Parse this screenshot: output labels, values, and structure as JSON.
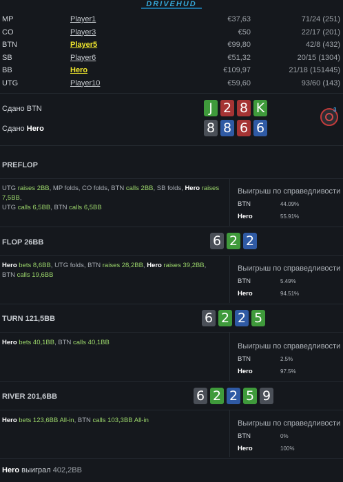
{
  "logo": "DRIVEHUD",
  "players": [
    {
      "pos": "MP",
      "name": "Player1",
      "stack": "€37,63",
      "stat": "71/24 (251)",
      "highlight": false
    },
    {
      "pos": "CO",
      "name": "Player3",
      "stack": "€50",
      "stat": "22/17 (201)",
      "highlight": false
    },
    {
      "pos": "BTN",
      "name": "Player5",
      "stack": "€99,80",
      "stat": "42/8 (432)",
      "highlight": true
    },
    {
      "pos": "SB",
      "name": "Player6",
      "stack": "€51,32",
      "stat": "20/15 (1304)",
      "highlight": false
    },
    {
      "pos": "BB",
      "name": "Hero",
      "stack": "€109,97",
      "stat": "21/18 (151445)",
      "highlight": true
    },
    {
      "pos": "UTG",
      "name": "Player10",
      "stack": "€59,60",
      "stat": "93/60 (143)",
      "highlight": false
    }
  ],
  "dealt": {
    "btn_label": "Сдано BTN",
    "hero_prefix": "Сдано",
    "hero_name": "Hero",
    "btn_cards": [
      {
        "rank": "J",
        "suit": "green"
      },
      {
        "rank": "2",
        "suit": "red"
      },
      {
        "rank": "8",
        "suit": "red"
      },
      {
        "rank": "K",
        "suit": "green"
      }
    ],
    "hero_cards": [
      {
        "rank": "8",
        "suit": "grey"
      },
      {
        "rank": "8",
        "suit": "blue"
      },
      {
        "rank": "6",
        "suit": "red"
      },
      {
        "rank": "6",
        "suit": "blue"
      }
    ]
  },
  "equity_title": "Выигрыш по справедливости",
  "streets": {
    "preflop": {
      "title": "PREFLOP",
      "actions": [
        [
          {
            "t": "UTG",
            "c": "p"
          },
          {
            "t": " raises ",
            "c": "act"
          },
          {
            "t": "2BB",
            "c": "amt"
          },
          {
            "t": ", MP folds, CO folds, BTN ",
            "c": "p"
          },
          {
            "t": "calls ",
            "c": "act"
          },
          {
            "t": "2BB",
            "c": "amt"
          },
          {
            "t": ", SB folds, ",
            "c": "p"
          },
          {
            "t": "Hero",
            "c": "hero"
          },
          {
            "t": " raises ",
            "c": "act"
          },
          {
            "t": "7,5BB",
            "c": "amt"
          },
          {
            "t": ",",
            "c": "p"
          }
        ],
        [
          {
            "t": "UTG ",
            "c": "p"
          },
          {
            "t": "calls ",
            "c": "act"
          },
          {
            "t": "6,5BB",
            "c": "amt"
          },
          {
            "t": ", BTN ",
            "c": "p"
          },
          {
            "t": "calls ",
            "c": "act"
          },
          {
            "t": "6,5BB",
            "c": "amt"
          }
        ]
      ],
      "equity": {
        "btn": "44.09%",
        "hero": "55.91%"
      }
    },
    "flop": {
      "title": "FLOP 26BB",
      "board": [
        {
          "rank": "6",
          "suit": "grey"
        },
        {
          "rank": "2",
          "suit": "green"
        },
        {
          "rank": "2",
          "suit": "blue"
        }
      ],
      "actions": [
        [
          {
            "t": "Hero",
            "c": "hero"
          },
          {
            "t": " bets ",
            "c": "act"
          },
          {
            "t": "8,6BB",
            "c": "amt"
          },
          {
            "t": ", UTG folds, BTN ",
            "c": "p"
          },
          {
            "t": "raises ",
            "c": "act"
          },
          {
            "t": "28,2BB",
            "c": "amt"
          },
          {
            "t": ", ",
            "c": "p"
          },
          {
            "t": "Hero",
            "c": "hero"
          },
          {
            "t": " raises ",
            "c": "act"
          },
          {
            "t": "39,2BB",
            "c": "amt"
          },
          {
            "t": ",",
            "c": "p"
          }
        ],
        [
          {
            "t": "BTN ",
            "c": "p"
          },
          {
            "t": "calls ",
            "c": "act"
          },
          {
            "t": "19,6BB",
            "c": "amt"
          }
        ]
      ],
      "equity": {
        "btn": "5.49%",
        "hero": "94.51%"
      }
    },
    "turn": {
      "title": "TURN 121,5BB",
      "board": [
        {
          "rank": "6",
          "suit": "grey"
        },
        {
          "rank": "2",
          "suit": "green"
        },
        {
          "rank": "2",
          "suit": "blue"
        },
        {
          "rank": "5",
          "suit": "green"
        }
      ],
      "actions": [
        [
          {
            "t": "Hero",
            "c": "hero"
          },
          {
            "t": " bets ",
            "c": "act"
          },
          {
            "t": "40,1BB",
            "c": "amt"
          },
          {
            "t": ", BTN ",
            "c": "p"
          },
          {
            "t": "calls ",
            "c": "act"
          },
          {
            "t": "40,1BB",
            "c": "amt"
          }
        ]
      ],
      "equity": {
        "btn": "2.5%",
        "hero": "97.5%"
      }
    },
    "river": {
      "title": "RIVER 201,6BB",
      "board": [
        {
          "rank": "6",
          "suit": "grey"
        },
        {
          "rank": "2",
          "suit": "green"
        },
        {
          "rank": "2",
          "suit": "blue"
        },
        {
          "rank": "5",
          "suit": "green"
        },
        {
          "rank": "9",
          "suit": "grey"
        }
      ],
      "actions": [
        [
          {
            "t": "Hero",
            "c": "hero"
          },
          {
            "t": " bets ",
            "c": "act"
          },
          {
            "t": "123,6BB All-in",
            "c": "amt"
          },
          {
            "t": ", BTN ",
            "c": "p"
          },
          {
            "t": "calls ",
            "c": "act"
          },
          {
            "t": "103,3BB All-in",
            "c": "amt"
          }
        ]
      ],
      "equity": {
        "btn": "0%",
        "hero": "100%"
      }
    }
  },
  "equity_labels": {
    "btn": "BTN",
    "hero": "Hero"
  },
  "result": {
    "hero": "Hero",
    "text": " выиграл ",
    "amount": "402,2BB"
  },
  "colors": {
    "green": "#3f9a3b",
    "red": "#a53434",
    "blue": "#2f5aa4",
    "grey": "#4a4f57",
    "highlight": "#f2e82d",
    "action": "#9ad46a"
  }
}
